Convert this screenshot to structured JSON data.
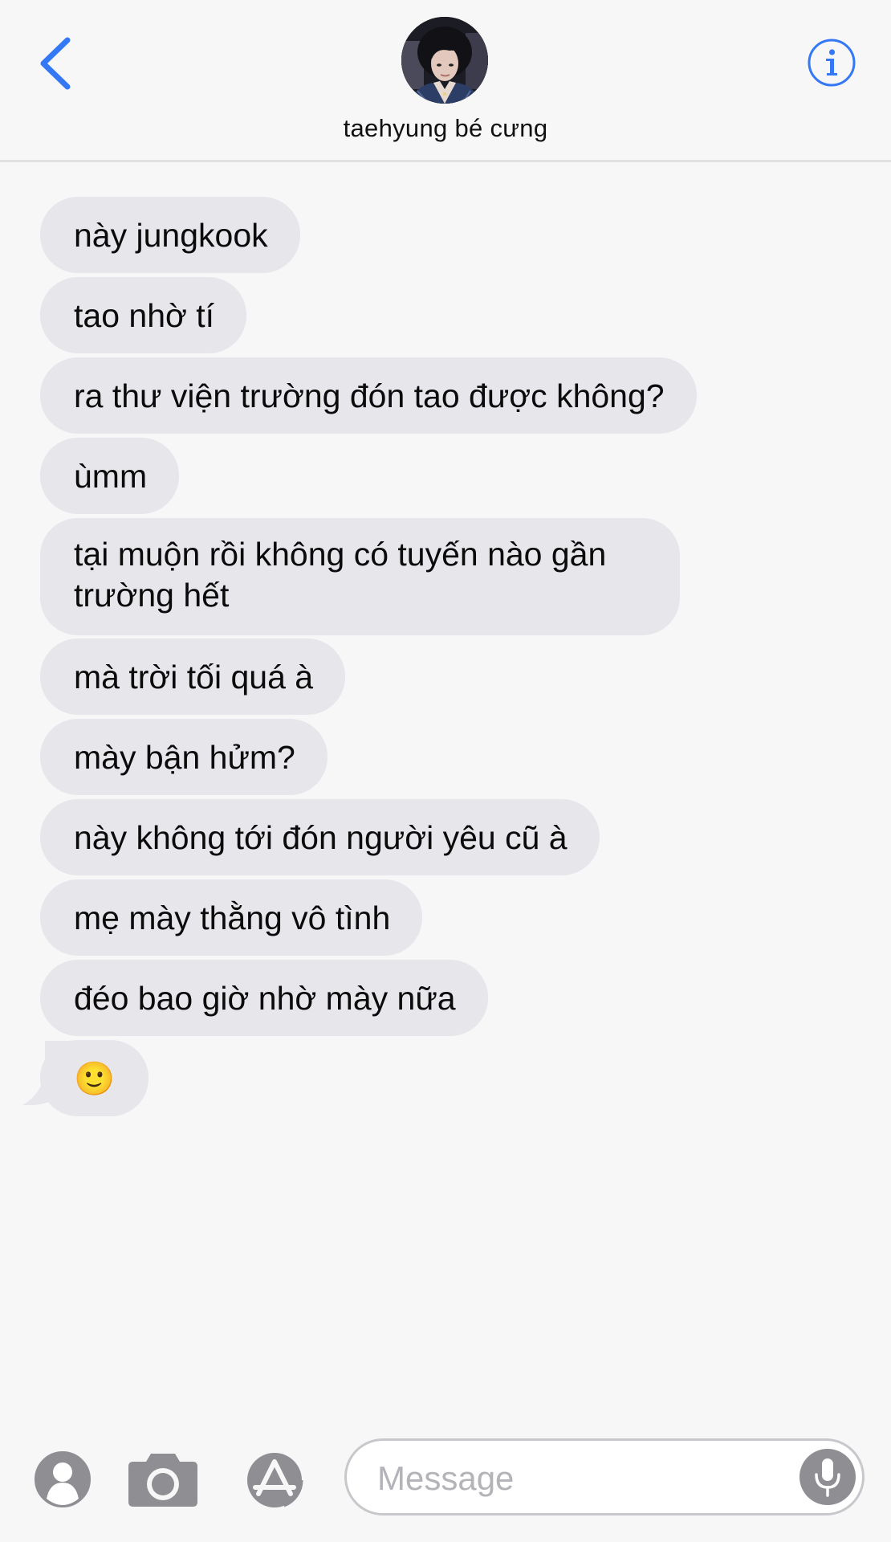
{
  "header": {
    "contact_name": "taehyung bé cưng",
    "back_icon": "chevron-left-icon",
    "info_icon": "info-circle-icon"
  },
  "messages": [
    {
      "text": "này jungkook"
    },
    {
      "text": "tao nhờ tí"
    },
    {
      "text": "ra thư viện trường đón tao được không?"
    },
    {
      "text": "ùmm"
    },
    {
      "text": "tại muộn rồi không có tuyến nào gần trường hết"
    },
    {
      "text": "mà trời tối quá à"
    },
    {
      "text": "mày bận hửm?"
    },
    {
      "text": "này không tới đón người yêu cũ à"
    },
    {
      "text": "mẹ mày thằng vô tình"
    },
    {
      "text": "đéo bao giờ nhờ mày nữa"
    },
    {
      "text": "🙂"
    }
  ],
  "input_bar": {
    "contacts_icon": "person-circle-icon",
    "camera_icon": "camera-icon",
    "apps_icon": "app-store-icon",
    "message_placeholder": "Message",
    "message_value": "",
    "mic_icon": "microphone-icon"
  },
  "colors": {
    "accent": "#3478f6",
    "bubble_received": "#e6e6eb",
    "background": "#f7f7f7",
    "icon_gray": "#8e8e93"
  }
}
